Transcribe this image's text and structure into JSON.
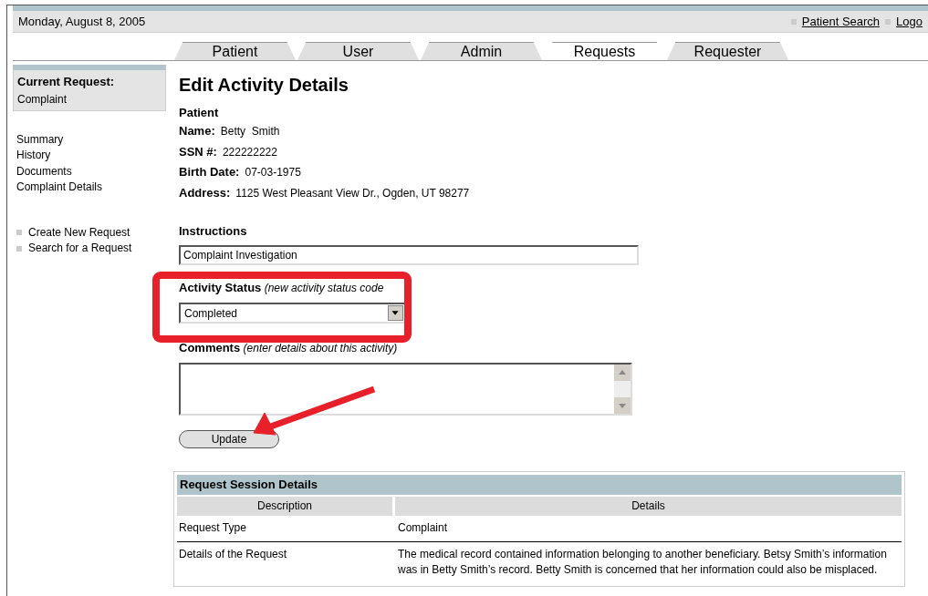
{
  "header": {
    "date": "Monday, August 8, 2005",
    "links": [
      "Patient Search",
      "Logo"
    ]
  },
  "tabs": [
    {
      "label": "Patient",
      "selected": false
    },
    {
      "label": "User",
      "selected": false
    },
    {
      "label": "Admin",
      "selected": false
    },
    {
      "label": "Requests",
      "selected": true
    },
    {
      "label": "Requester",
      "selected": false
    }
  ],
  "sidebar": {
    "current_request": {
      "label": "Current Request:",
      "value": "Complaint"
    },
    "nav_links": [
      "Summary",
      "History",
      "Documents",
      "Complaint Details"
    ],
    "actions": [
      "Create New Request",
      "Search for a Request"
    ]
  },
  "main": {
    "title": "Edit Activity Details",
    "patient": {
      "heading": "Patient",
      "fields": [
        {
          "label": "Name:",
          "value": "Betty  Smith"
        },
        {
          "label": "SSN #:",
          "value": "222222222"
        },
        {
          "label": "Birth Date:",
          "value": "07-03-1975"
        },
        {
          "label": "Address:",
          "value": "1125 West Pleasant View Dr., Ogden, UT 98277"
        }
      ]
    },
    "instructions": {
      "label": "Instructions",
      "value": "Complaint Investigation"
    },
    "activity_status": {
      "label": "Activity Status",
      "hint": "(new activity status code",
      "value": "Completed"
    },
    "comments": {
      "label": "Comments",
      "hint": "(enter details about this activity)"
    },
    "update_button": "Update"
  },
  "session_details": {
    "title": "Request Session Details",
    "columns": [
      "Description",
      "Details"
    ],
    "rows": [
      [
        "Request Type",
        "Complaint"
      ],
      [
        "Details of the Request",
        "The medical record contained information belonging to another beneficiary. Betsy Smith’s information was in Betty Smith’s record. Betty Smith is concerned that her information could also be misplaced."
      ]
    ]
  }
}
